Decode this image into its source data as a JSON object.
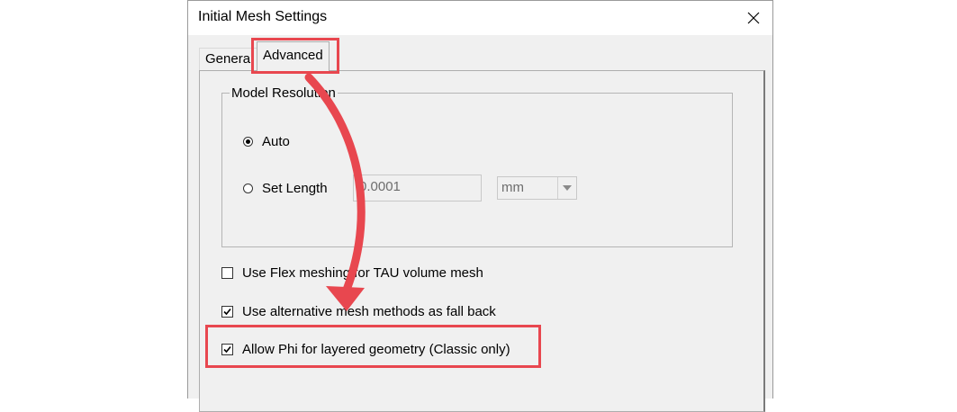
{
  "window": {
    "title": "Initial Mesh Settings"
  },
  "tabs": [
    {
      "label": "General",
      "active": false
    },
    {
      "label": "Advanced",
      "active": true
    }
  ],
  "model_resolution": {
    "legend": "Model Resolution",
    "auto_label": "Auto",
    "set_length_label": "Set Length",
    "selected": "Auto",
    "length_value": "0.0001",
    "unit_value": "mm"
  },
  "options": {
    "flex_meshing_label": "Use Flex meshing for TAU volume mesh",
    "flex_meshing_checked": false,
    "alt_methods_label": "Use alternative mesh methods as fall back",
    "alt_methods_checked": true,
    "allow_phi_label": "Allow Phi for layered geometry (Classic only)",
    "allow_phi_checked": true
  },
  "annotation": {
    "color": "#e8474f"
  }
}
